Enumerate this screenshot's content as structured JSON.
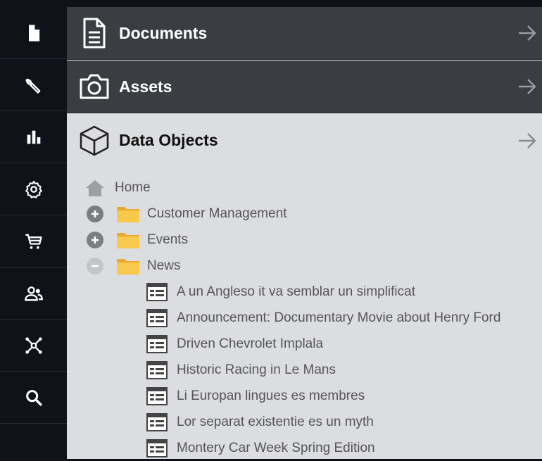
{
  "colors": {
    "rail_bg": "#0f1218",
    "panel_dark": "#3a3d42",
    "panel_light": "#dcdde0",
    "folder": "#f9c94b"
  },
  "rail": {
    "items": [
      {
        "icon": "document-icon"
      },
      {
        "icon": "wrench-icon"
      },
      {
        "icon": "bar-chart-icon"
      },
      {
        "icon": "gear-icon"
      },
      {
        "icon": "cart-icon"
      },
      {
        "icon": "users-icon"
      },
      {
        "icon": "network-icon"
      },
      {
        "icon": "search-icon"
      }
    ]
  },
  "panels": {
    "documents": {
      "title": "Documents",
      "icon": "document-icon"
    },
    "assets": {
      "title": "Assets",
      "icon": "camera-icon"
    },
    "data_objects": {
      "title": "Data Objects",
      "icon": "cube-icon"
    }
  },
  "tree": {
    "home": {
      "label": "Home"
    },
    "folders": [
      {
        "label": "Customer Management",
        "state": "collapsed"
      },
      {
        "label": "Events",
        "state": "collapsed"
      },
      {
        "label": "News",
        "state": "expanded"
      }
    ],
    "news_items": [
      "A un Angleso it va semblar un simplificat",
      "Announcement: Documentary Movie about Henry Ford",
      "Driven Chevrolet Implala",
      "Historic Racing in Le Mans",
      "Li Europan lingues es membres",
      "Lor separat existentie es un myth",
      "Montery Car Week Spring Edition"
    ]
  }
}
